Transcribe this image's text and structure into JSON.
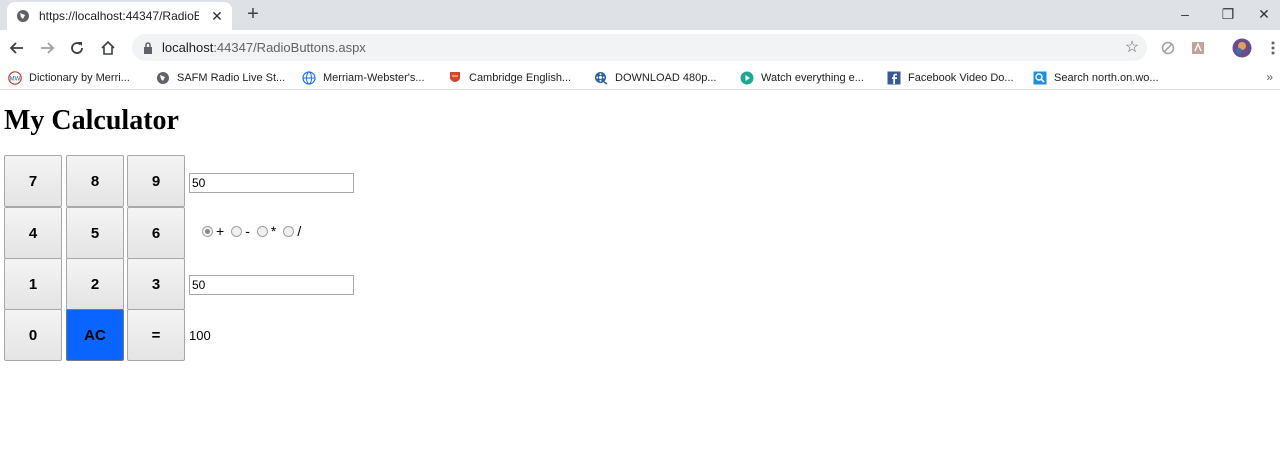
{
  "browser": {
    "tab": {
      "title": "https://localhost:44347/RadioBut",
      "close_glyph": "✕"
    },
    "new_tab_glyph": "+",
    "window_controls": {
      "minimize": "–",
      "restore": "❐",
      "close": "✕"
    },
    "address": {
      "host": "localhost",
      "rest": ":44347/RadioButtons.aspx"
    },
    "bookmarks": [
      {
        "label": "Dictionary by Merri...",
        "icon": "merriam-webster-icon"
      },
      {
        "label": "SAFM Radio Live St...",
        "icon": "globe-dark-icon"
      },
      {
        "label": "Merriam-Webster's...",
        "icon": "globe-icon"
      },
      {
        "label": "Cambridge English...",
        "icon": "cambridge-crest-icon"
      },
      {
        "label": "DOWNLOAD 480p...",
        "icon": "film-reel-icon"
      },
      {
        "label": "Watch everything e...",
        "icon": "play-icon"
      },
      {
        "label": "Facebook Video Do...",
        "icon": "facebook-icon"
      },
      {
        "label": "Search north.on.wo...",
        "icon": "search-site-icon"
      }
    ],
    "bookmarks_more": "»"
  },
  "calculator": {
    "title": "My Calculator",
    "keys": {
      "k7": "7",
      "k8": "8",
      "k9": "9",
      "k4": "4",
      "k5": "5",
      "k6": "6",
      "k1": "1",
      "k2": "2",
      "k3": "3",
      "k0": "0",
      "ac": "AC",
      "equals": "="
    },
    "first_operand": "50",
    "second_operand": "50",
    "operations": [
      {
        "label": "+",
        "selected": true
      },
      {
        "label": "-",
        "selected": false
      },
      {
        "label": "*",
        "selected": false
      },
      {
        "label": "/",
        "selected": false
      }
    ],
    "result": "100",
    "colors": {
      "ac_key": "#0a64ff"
    }
  }
}
